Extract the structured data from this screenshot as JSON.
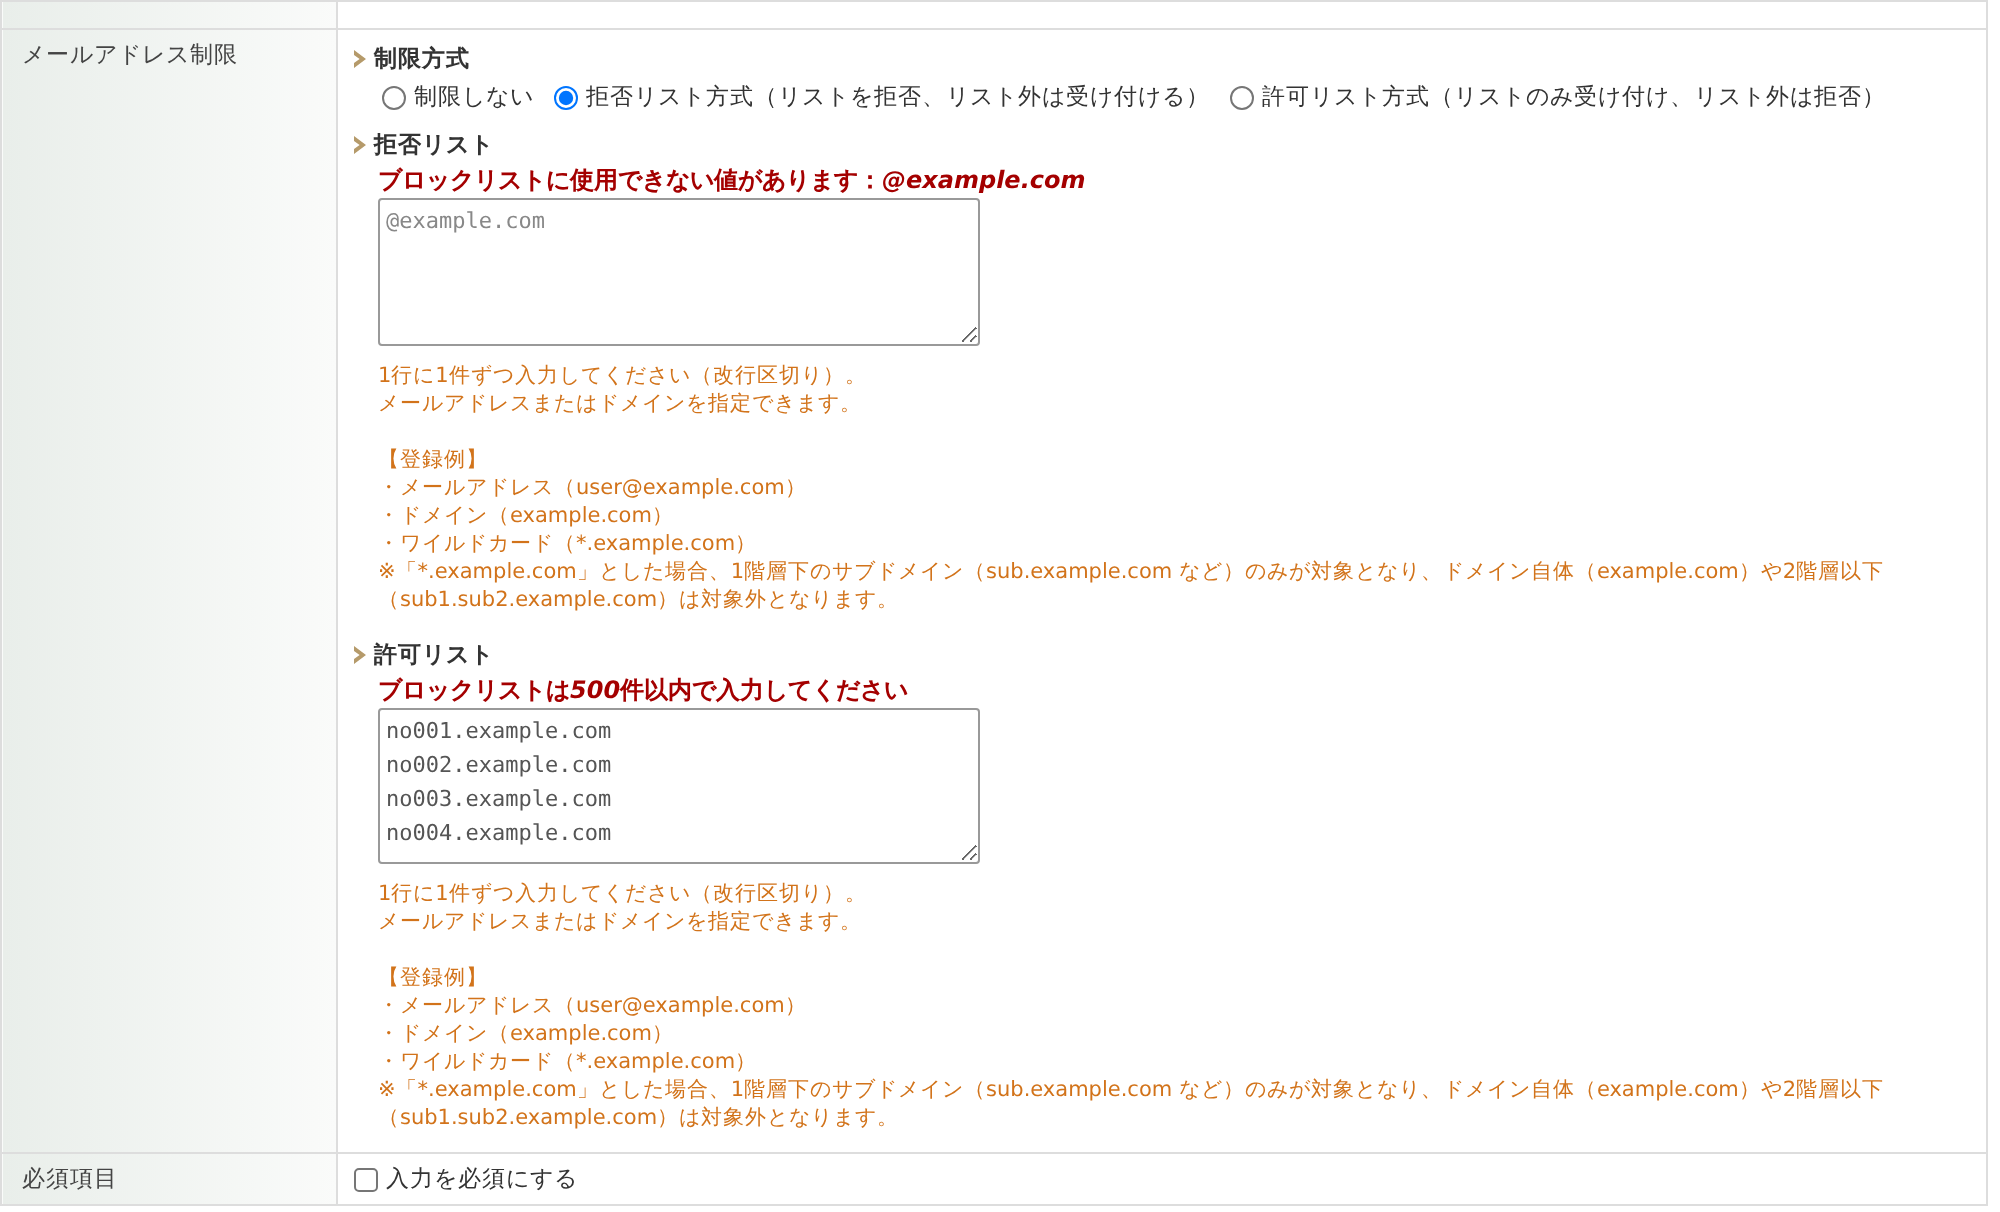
{
  "rows": [
    {
      "kind": "blank"
    },
    {
      "kind": "email",
      "label": "メールアドレス制限",
      "method": {
        "heading": "制限方式",
        "options": [
          {
            "label": "制限しない",
            "selected": false
          },
          {
            "label": "拒否リスト方式（リストを拒否、リスト外は受け付ける）",
            "selected": true
          },
          {
            "label": "許可リスト方式（リストのみ受け付け、リスト外は拒否）",
            "selected": false
          }
        ]
      },
      "lists": [
        {
          "heading": "拒否リスト",
          "error": [
            {
              "text": "ブロックリストに使用できない値があります：",
              "italic": false
            },
            {
              "text": "@example.com",
              "italic": true
            }
          ],
          "placeholder": "@example.com",
          "help": {
            "intro": [
              "1行に1件ずつ入力してください（改行区切り）。",
              "メールアドレスまたはドメインを指定できます。"
            ],
            "examples_title": "【登録例】",
            "examples": [
              "・メールアドレス（user@example.com）",
              "・ドメイン（example.com）",
              "・ワイルドカード（*.example.com）"
            ],
            "note": [
              "※「*.example.com」とした場合、1階層下のサブドメイン（sub.example.com など）のみが対象となり、ドメイン自体（example.com）や2階層以下",
              "（sub1.sub2.example.com）は対象外となります。"
            ]
          }
        },
        {
          "heading": "許可リスト",
          "error": [
            {
              "text": "ブロックリストは",
              "italic": false
            },
            {
              "text": "500",
              "italic": true
            },
            {
              "text": "件以内で入力してください",
              "italic": false
            }
          ],
          "lines": [
            "no001.example.com",
            "no002.example.com",
            "no003.example.com",
            "no004.example.com"
          ],
          "help": {
            "intro": [
              "1行に1件ずつ入力してください（改行区切り）。",
              "メールアドレスまたはドメインを指定できます。"
            ],
            "examples_title": "【登録例】",
            "examples": [
              "・メールアドレス（user@example.com）",
              "・ドメイン（example.com）",
              "・ワイルドカード（*.example.com）"
            ],
            "note": [
              "※「*.example.com」とした場合、1階層下のサブドメイン（sub.example.com など）のみが対象となり、ドメイン自体（example.com）や2階層以下",
              "（sub1.sub2.example.com）は対象外となります。"
            ]
          }
        }
      ]
    },
    {
      "kind": "required",
      "label": "必須項目",
      "checkbox": {
        "label": "入力を必須にする",
        "checked": false
      }
    }
  ]
}
